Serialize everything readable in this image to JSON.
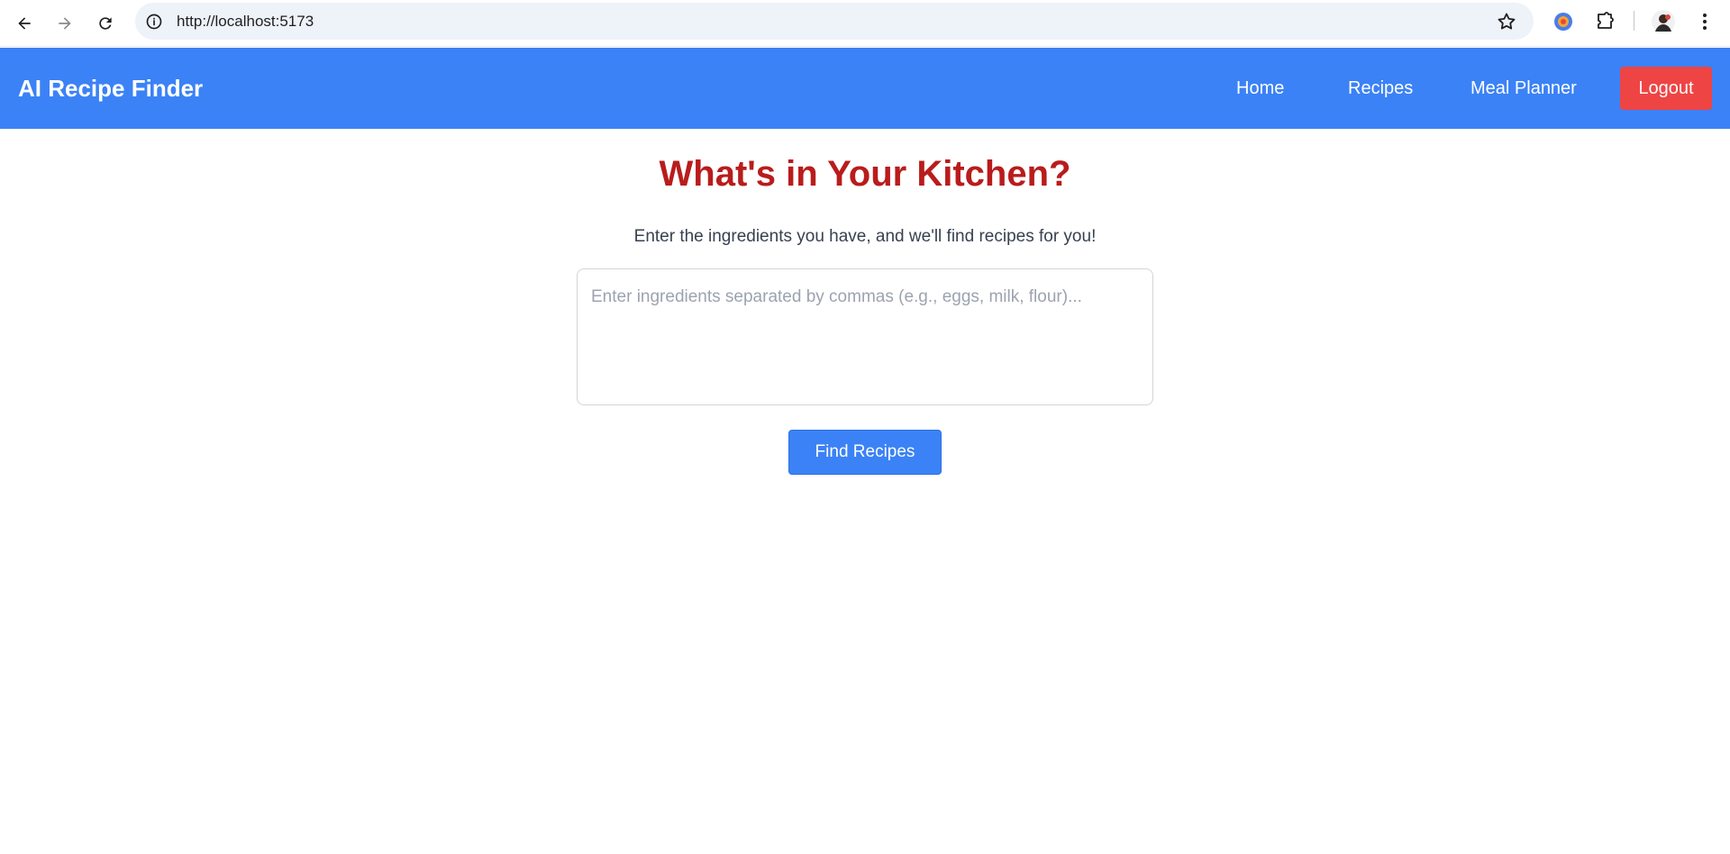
{
  "browser": {
    "url": "http://localhost:5173",
    "icons": [
      "back-icon",
      "forward-icon",
      "reload-icon",
      "info-icon",
      "star-icon",
      "extension-badge-icon",
      "puzzle-icon",
      "avatar",
      "more-vert-icon"
    ]
  },
  "navbar": {
    "brand": "AI Recipe Finder",
    "links": [
      "Home",
      "Recipes",
      "Meal Planner"
    ],
    "logout_label": "Logout",
    "colors": {
      "bar": "#3b82f6",
      "logout": "#ef4444"
    }
  },
  "main": {
    "title": "What's in Your Kitchen?",
    "subtitle": "Enter the ingredients you have, and we'll find recipes for you!",
    "ingredients_placeholder": "Enter ingredients separated by commas (e.g., eggs, milk, flour)...",
    "ingredients_value": "",
    "find_button_label": "Find Recipes",
    "colors": {
      "title": "#b91c1c",
      "button": "#3b82f6"
    }
  }
}
